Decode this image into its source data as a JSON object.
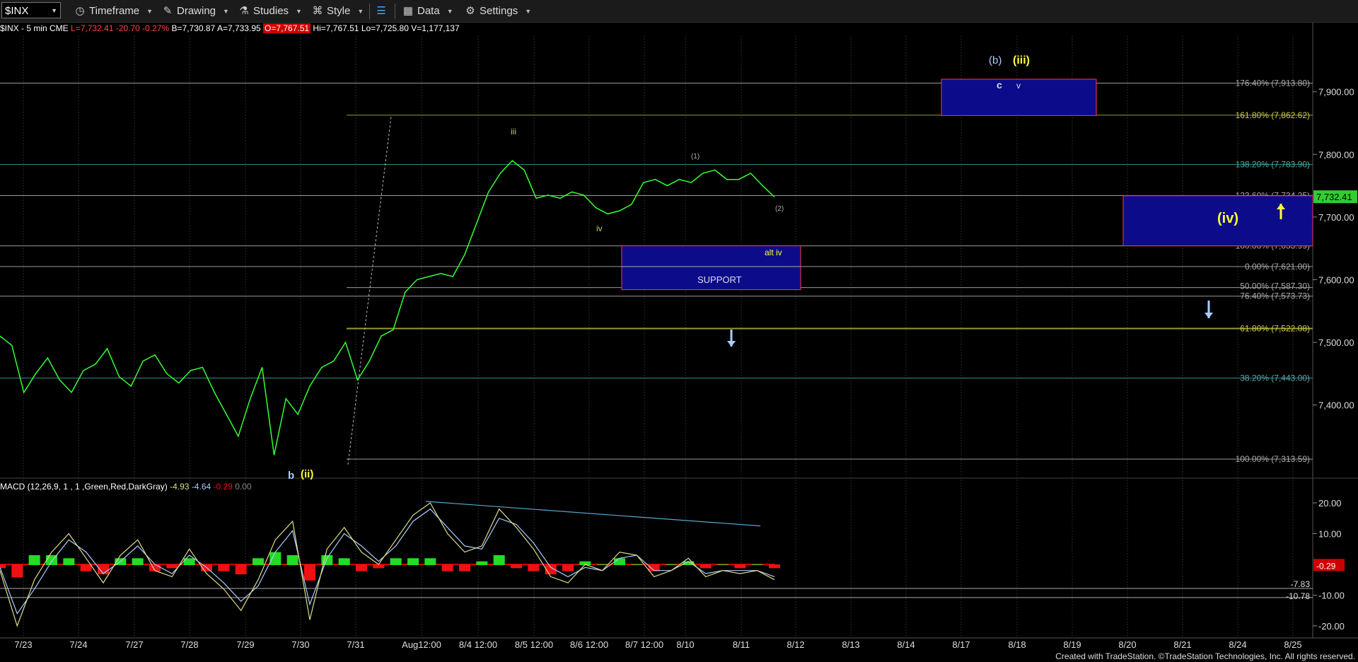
{
  "toolbar": {
    "symbol": "$INX",
    "items": [
      {
        "name": "timeframe",
        "label": "Timeframe",
        "icon": "clock-icon"
      },
      {
        "name": "drawing",
        "label": "Drawing",
        "icon": "pencil-icon"
      },
      {
        "name": "studies",
        "label": "Studies",
        "icon": "flask-icon"
      },
      {
        "name": "style",
        "label": "Style",
        "icon": "style-icon"
      },
      {
        "name": "data",
        "label": "Data",
        "icon": "table-icon"
      },
      {
        "name": "settings",
        "label": "Settings",
        "icon": "gear-icon"
      }
    ]
  },
  "info": {
    "name": "$INX - 5 min  CME",
    "last": "L=7,732.41",
    "change": "-20.70",
    "pct": "-0.27%",
    "bid": "B=7,730.87",
    "ask": "A=7,733.95",
    "open": "O=7,767.51",
    "hi": "Hi=7,767.51",
    "lo": "Lo=7,725.80",
    "vol": "V=1,177,137"
  },
  "macd_info": {
    "name": "MACD (12,26,9, 1 , 1 ,Green,Red,DarkGray)",
    "v1": "-4.93",
    "v2": "-4.64",
    "v3": "-0.29",
    "v4": "0.00"
  },
  "colors": {
    "price": "#33ff33",
    "macd_line": "#dddd88",
    "signal_line": "#aaccff",
    "hist_up": "#22dd22",
    "hist_down": "#ee1111",
    "box_fill": "#0c0c8a",
    "box_border": "#ff3355",
    "label_yellow": "#ffff33",
    "fib_olive": "#999933",
    "fib_teal": "#55aaaa"
  },
  "chart_data": {
    "type": "line",
    "xlabels": [
      "7/23",
      "7/24",
      "7/27",
      "7/28",
      "7/29",
      "7/30",
      "7/31",
      "Aug12:00",
      "8/4 12:00",
      "8/5 12:00",
      "8/6 12:00",
      "8/7 12:00",
      "8/10",
      "8/11",
      "8/12",
      "8/13",
      "8/14",
      "8/17",
      "8/18",
      "8/19",
      "8/20",
      "8/21",
      "8/24",
      "8/25"
    ],
    "ylim": [
      7290,
      7990
    ],
    "yticks": [
      "7,900.00",
      "7,800.00",
      "7,700.00",
      "7,600.00",
      "7,500.00",
      "7,400.00"
    ],
    "last_price": "7,732.41",
    "series": [
      {
        "values": [
          7510,
          7495,
          7420,
          7450,
          7475,
          7440,
          7420,
          7455,
          7465,
          7490,
          7445,
          7430,
          7470,
          7480,
          7450,
          7435,
          7455,
          7460,
          7420,
          7385,
          7350,
          7410,
          7460,
          7320,
          7410,
          7385,
          7430,
          7460,
          7470,
          7500,
          7440,
          7470,
          7510,
          7520,
          7580,
          7600,
          7605,
          7610,
          7605,
          7640,
          7690,
          7740,
          7770,
          7790,
          7775,
          7730,
          7735,
          7730,
          7740,
          7735,
          7715,
          7705,
          7710,
          7720,
          7755,
          7760,
          7750,
          7760,
          7755,
          7770,
          7775,
          7760,
          7760,
          7770,
          7750,
          7732
        ]
      }
    ],
    "fib_levels": [
      {
        "label": "176.40% (7,913.80)",
        "value": 7913.8
      },
      {
        "label": "161.80% (7,862.62)",
        "value": 7862.6
      },
      {
        "label": "138.20% (7,783.90)",
        "value": 7783.9
      },
      {
        "label": "123.60% (7,734.25)",
        "value": 7734.25
      },
      {
        "label": "100.00% (7,653.99)",
        "value": 7653.99
      },
      {
        "label": "0.00% (7,621.00)",
        "value": 7621.0
      },
      {
        "label": "50.00% (7,587.30)",
        "value": 7587.3
      },
      {
        "label": "76.40% (7,573.73)",
        "value": 7573.73
      },
      {
        "label": "61.80% (7,522.08)",
        "value": 7522.08
      },
      {
        "label": "38.20% (7,443.00)",
        "value": 7443.0
      },
      {
        "label": "100.00% (7,313.59)",
        "value": 7313.59
      }
    ],
    "annotations": {
      "b_ii_b": "b",
      "b_ii_ii": "(ii)",
      "iii": "iii",
      "iv": "iv",
      "wave1": "(1)",
      "wave2": "(2)",
      "alt_iv": "alt iv",
      "support": "SUPPORT",
      "big_b": "(b)",
      "big_iii": "(iii)",
      "c": "c",
      "v": "v",
      "big_iv": "(iv)"
    },
    "macd": {
      "ylim": [
        -23,
        23
      ],
      "yticks": [
        "20.00",
        "10.00",
        "-10.00",
        "-20.00"
      ],
      "hline_labels": [
        "-0.29",
        "-7.83",
        "-10.78"
      ],
      "macd": [
        -2,
        -20,
        -5,
        4,
        10,
        2,
        -6,
        3,
        8,
        -2,
        -4,
        5,
        -3,
        -8,
        -15,
        -5,
        8,
        14,
        -18,
        5,
        12,
        4,
        0,
        8,
        16,
        20,
        10,
        4,
        6,
        18,
        12,
        5,
        -4,
        -6,
        0,
        -2,
        4,
        3,
        -4,
        -2,
        2,
        -4,
        -2,
        -3,
        -2,
        -5
      ],
      "signal": [
        -1,
        -16,
        -8,
        1,
        8,
        4,
        -3,
        1,
        6,
        0,
        -3,
        3,
        -1,
        -6,
        -12,
        -7,
        4,
        11,
        -13,
        2,
        10,
        6,
        1,
        6,
        14,
        18,
        12,
        6,
        5,
        15,
        13,
        7,
        -1,
        -4,
        -1,
        -2,
        2,
        3,
        -2,
        -2,
        1,
        -3,
        -2,
        -2,
        -2,
        -4
      ]
    },
    "credit": "Created with TradeStation. ©TradeStation Technologies, Inc. All rights reserved."
  }
}
